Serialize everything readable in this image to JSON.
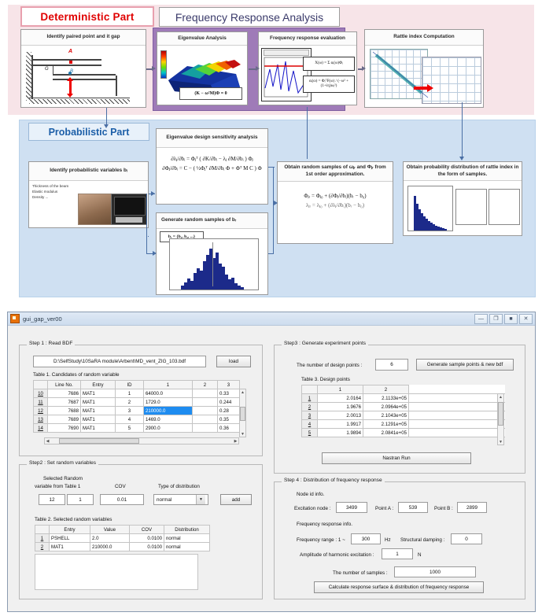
{
  "diagram": {
    "deterministic_header": "Deterministic Part",
    "fra_header": "Frequency Response Analysis",
    "probabilistic_header": "Probabilistic Part",
    "nodes": {
      "identify_gap": "Identify paired point and it gap",
      "eigenvalue": "Eigenvalue Analysis",
      "eigen_equation": "(K − ω²M)Φ = 0",
      "freq_eval": "Frequency response evaluation",
      "freq_formula_1": "X(ω) = Σ αᵢ(ω)Φᵢ",
      "freq_formula_2": "αᵢ(ω) = ΦᵢᵀF(ω) / (−ω² + (1+iη)ωᵢ²)",
      "rattle": "Rattle index Computation",
      "prob_vars": "Identify probabilistic variables bᵢ",
      "prob_vars_list": "Thickness of the beam\nElastic modulus\nDensity ...",
      "eigen_sens": "Eigenvalue design sensitivity analysis",
      "sens_eq_1": "∂λⱼ/∂bᵢ = Φⱼᵀ ( ∂K/∂bᵢ − λⱼ ∂M/∂bᵢ ) Φⱼ",
      "sens_eq_2": "∂Φⱼ/∂bᵢ = C − ( ½Φⱼᵀ ∂M/∂bᵢ Φ + Φᵀ M C ) Φ",
      "gen_samples": "Generate random samples of bᵣ",
      "gen_samples_eq": "bᵣ = {b₁, b₂, ...}",
      "obtain_samples": "Obtain random samples of ωⱼᵣ and Φⱼᵣ from 1st order approximation.",
      "obtain_eq_1": "Φⱼᵣ = Φⱼ₀ + (∂Φⱼ/∂bᵢ)(bᵣ − b₀)",
      "obtain_eq_2": "λⱼᵣ = λⱼ₀ + (∂λⱼ/∂bᵢ)(bᵣ − b₀)",
      "prob_dist": "Obtain probability distribution of rattle index in the form of samples."
    },
    "beam_labels": {
      "a": "A",
      "g": "G",
      "b": "B"
    },
    "colors": {
      "deterministic_band": "#f7e4e8",
      "probabilistic_band": "#cfe0f2",
      "fra_frame": "#9f7bb8",
      "red_title": "#e00000",
      "blue_title": "#1d5fa8",
      "histogram": "#1c2a8a"
    }
  },
  "gui": {
    "title": "gui_gap_ver00",
    "window_buttons": [
      "—",
      "❐",
      "■",
      "✕"
    ],
    "step1": {
      "legend": "Step 1 : Read BDF",
      "bdf_path": "D:\\SelfStudy\\10SaRA module\\Arbent\\MD_vent_ZIG_103.bdf",
      "load_button": "load",
      "table_caption": "Table 1. Candidates of random variable",
      "columns": [
        "",
        "Line No.",
        "Entry",
        "ID",
        "1",
        "2",
        "3"
      ],
      "rows": [
        {
          "rh": "10",
          "line": "7686",
          "entry": "MAT1",
          "id": "1",
          "c1": "64000.0",
          "c2": "",
          "c3": "0.33",
          "highlight": false
        },
        {
          "rh": "11",
          "line": "7687",
          "entry": "MAT1",
          "id": "2",
          "c1": "1729.0",
          "c2": "",
          "c3": "0.244",
          "highlight": false
        },
        {
          "rh": "12",
          "line": "7688",
          "entry": "MAT1",
          "id": "3",
          "c1": "210000.0",
          "c2": "",
          "c3": "0.28",
          "highlight": true
        },
        {
          "rh": "13",
          "line": "7689",
          "entry": "MAT1",
          "id": "4",
          "c1": "1469.0",
          "c2": "",
          "c3": "0.35",
          "highlight": false
        },
        {
          "rh": "14",
          "line": "7690",
          "entry": "MAT1",
          "id": "5",
          "c1": "2900.0",
          "c2": "",
          "c3": "0.36",
          "highlight": false
        }
      ]
    },
    "step2": {
      "legend": "Step2 : Set random variables",
      "selected_label_line1": "Selected Random",
      "selected_label_line2": "variable from Table 1",
      "selected_row": "12",
      "selected_col": "1",
      "cov_label": "COV",
      "cov_value": "0.01",
      "dist_label": "Type of distribution",
      "dist_value": "normal",
      "add_button": "add",
      "table_caption": "Table 2. Selected random variables",
      "columns": [
        "",
        "Entry",
        "Value",
        "COV",
        "Distribution"
      ],
      "rows": [
        {
          "rh": "1",
          "entry": "PSHELL",
          "value": "2.0",
          "cov": "0.0100",
          "dist": "normal"
        },
        {
          "rh": "2",
          "entry": "MAT1",
          "value": "210000.0",
          "cov": "0.0100",
          "dist": "normal"
        }
      ]
    },
    "step3": {
      "legend": "Step3 : Generate experiment points",
      "num_points_label": "The number of design points :",
      "num_points_value": "6",
      "generate_button": "Generate sample points & new bdf",
      "table_caption": "Table 3. Design points",
      "columns": [
        "",
        "1",
        "2"
      ],
      "rows": [
        {
          "rh": "1",
          "c1": "2.0164",
          "c2": "2.1133e+05"
        },
        {
          "rh": "2",
          "c1": "1.9676",
          "c2": "2.0964e+05"
        },
        {
          "rh": "3",
          "c1": "2.0013",
          "c2": "2.1043e+05"
        },
        {
          "rh": "4",
          "c1": "1.9917",
          "c2": "2.1291e+05"
        },
        {
          "rh": "5",
          "c1": "1.9894",
          "c2": "2.0841e+05"
        }
      ],
      "nastran_button": "Nastran Run"
    },
    "step4": {
      "legend": "Step 4 : Distribution of frequency response",
      "node_info_label": "Node id info.",
      "excitation_label": "Excitation node :",
      "excitation_value": "3499",
      "point_a_label": "Point A :",
      "point_a_value": "539",
      "point_b_label": "Point B :",
      "point_b_value": "2899",
      "freq_info_label": "Frequency response info.",
      "freq_range_label": "Frequency range : 1 ~",
      "freq_range_value": "300",
      "freq_unit": "Hz",
      "damping_label": "Structural damping :",
      "damping_value": "0",
      "amplitude_label": "Amplitude of harmonic excitation :",
      "amplitude_value": "1",
      "amplitude_unit": "N",
      "samples_label": "The number of samples :",
      "samples_value": "1000",
      "calc_button": "Calculate response surface & distribution of frequency response"
    }
  }
}
